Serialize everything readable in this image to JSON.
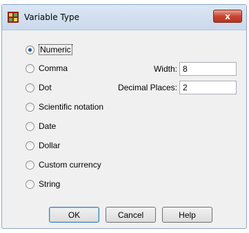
{
  "window": {
    "title": "Variable Type",
    "close_label": "x"
  },
  "radios": [
    {
      "label": "Numeric",
      "checked": true
    },
    {
      "label": "Comma",
      "checked": false
    },
    {
      "label": "Dot",
      "checked": false
    },
    {
      "label": "Scientific notation",
      "checked": false
    },
    {
      "label": "Date",
      "checked": false
    },
    {
      "label": "Dollar",
      "checked": false
    },
    {
      "label": "Custom currency",
      "checked": false
    },
    {
      "label": "String",
      "checked": false
    }
  ],
  "fields": {
    "width_label": "Width:",
    "width_value": "8",
    "decimal_label": "Decimal Places:",
    "decimal_value": "2"
  },
  "buttons": {
    "ok": "OK",
    "cancel": "Cancel",
    "help": "Help"
  }
}
